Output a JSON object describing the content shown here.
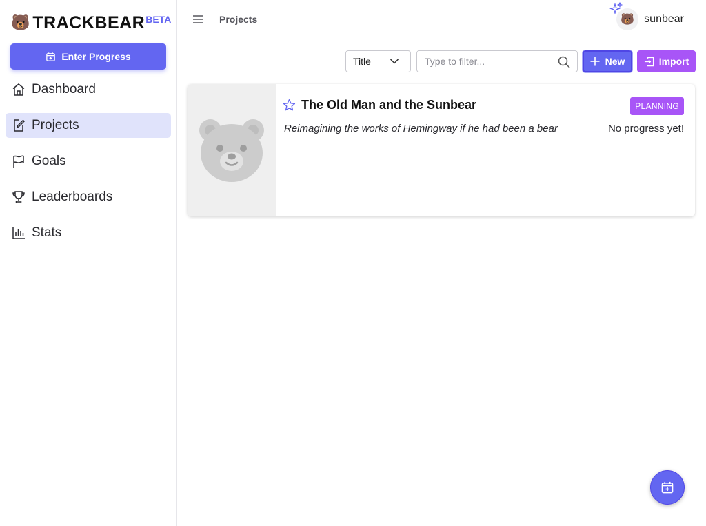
{
  "app": {
    "logo_emoji": "🐻",
    "name": "TRACKBEAR",
    "beta_label": "BETA",
    "accent_color": "#6366f1",
    "secondary_color": "#a855f7"
  },
  "sidebar": {
    "enter_progress_label": "Enter Progress",
    "items": [
      {
        "label": "Dashboard",
        "icon": "home-icon"
      },
      {
        "label": "Projects",
        "icon": "edit-note-icon",
        "active": true
      },
      {
        "label": "Goals",
        "icon": "flag-icon"
      },
      {
        "label": "Leaderboards",
        "icon": "trophy-icon"
      },
      {
        "label": "Stats",
        "icon": "bar-chart-icon"
      }
    ]
  },
  "header": {
    "breadcrumb": "Projects",
    "user": {
      "avatar_emoji": "🐻",
      "name": "sunbear"
    }
  },
  "toolbar": {
    "sort_value": "Title",
    "filter_placeholder": "Type to filter...",
    "new_label": "New",
    "import_label": "Import"
  },
  "projects": [
    {
      "title": "The Old Man and the Sunbear",
      "description": "Reimagining the works of Hemingway if he had been a bear",
      "status": "PLANNING",
      "progress_text": "No progress yet!",
      "starred": false
    }
  ]
}
